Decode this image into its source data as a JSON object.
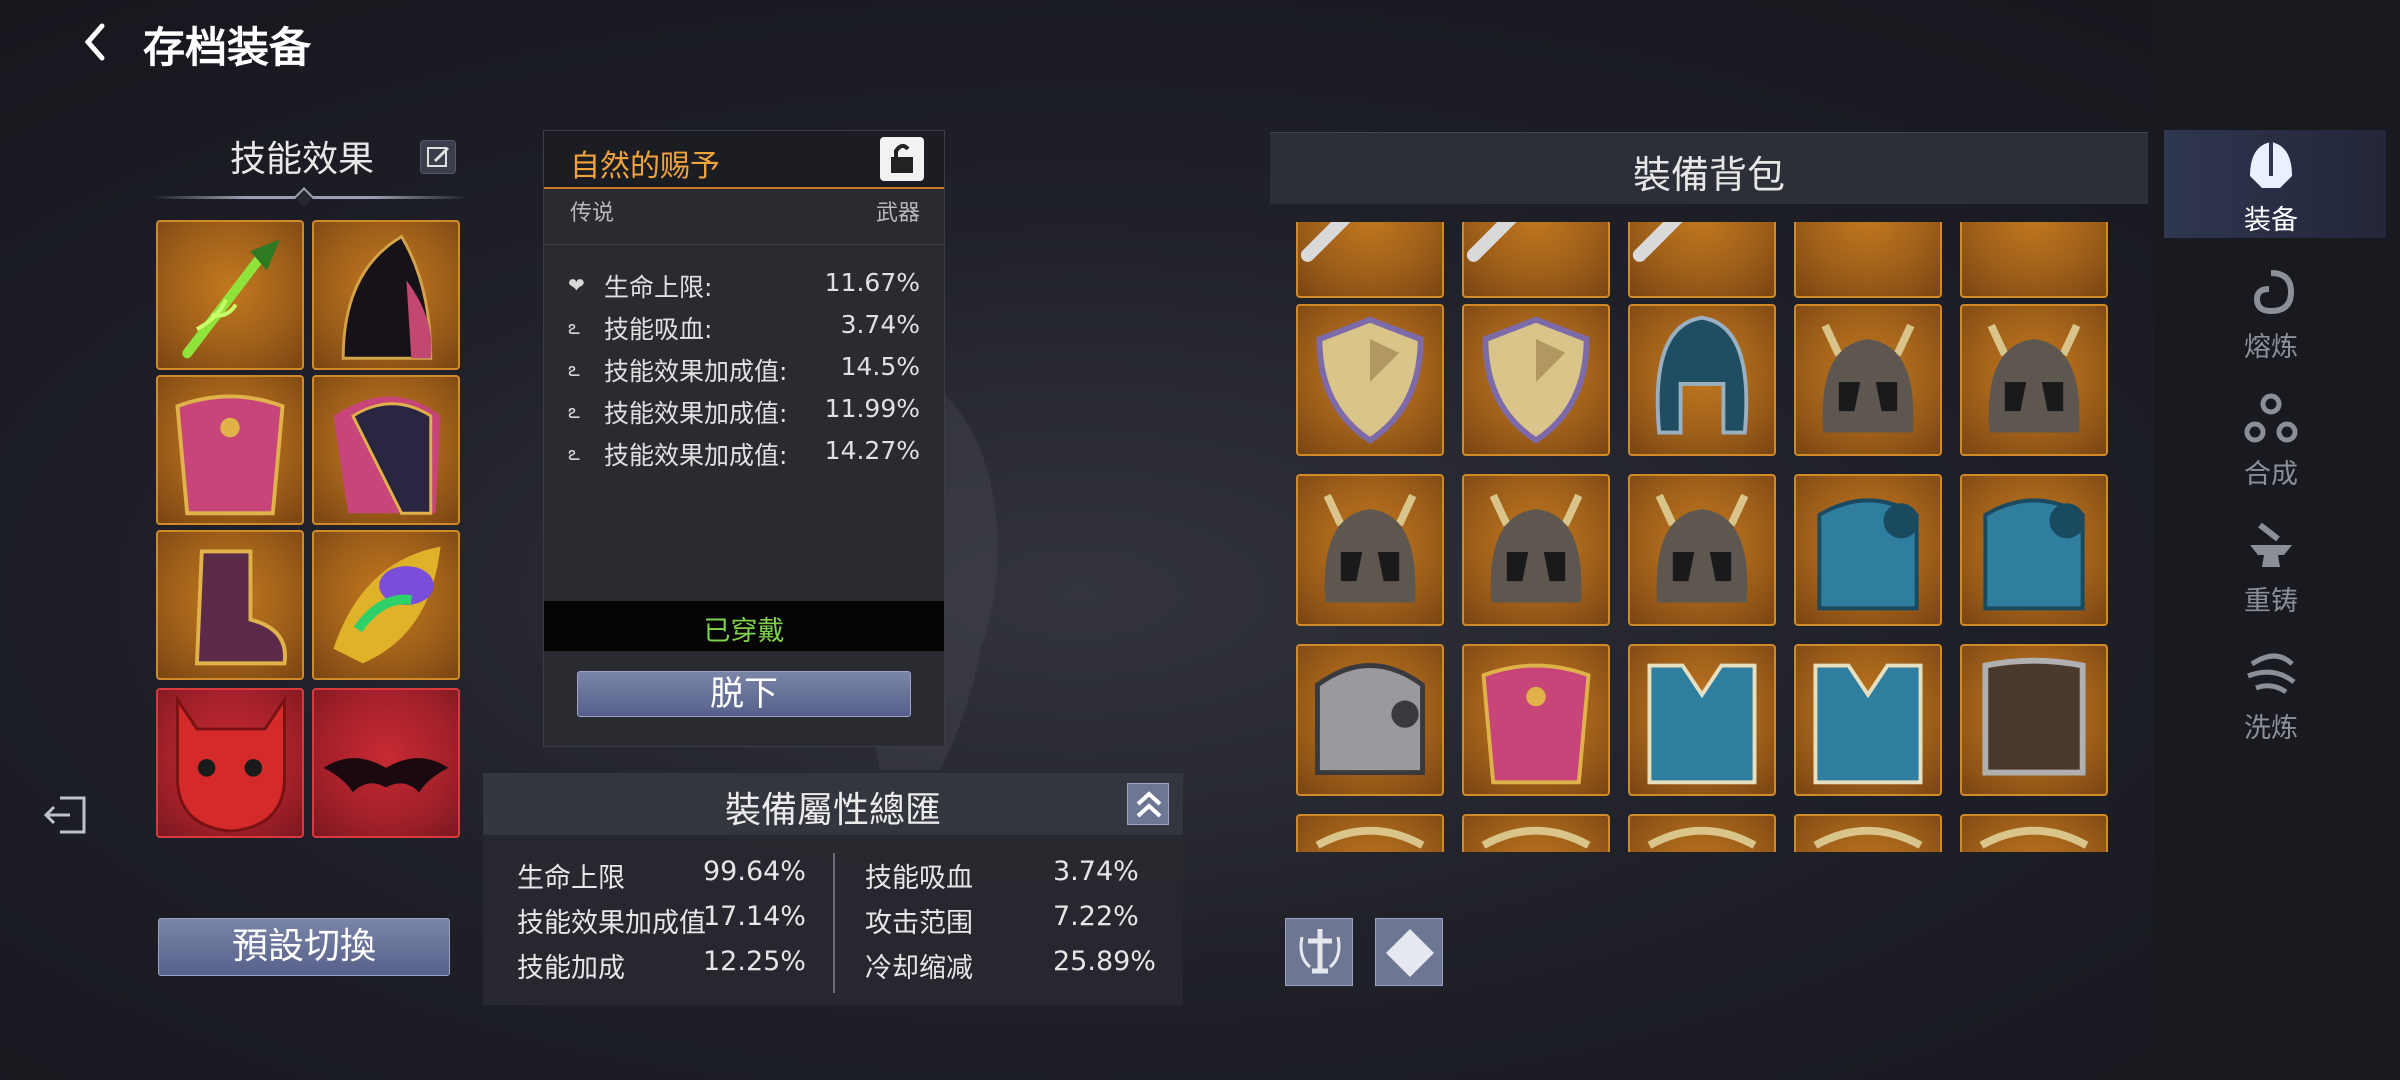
{
  "header": {
    "back_icon": "chevron-left-icon",
    "title": "存档装备"
  },
  "skill_panel": {
    "title": "技能效果",
    "edit_icon": "edit-icon",
    "slots": [
      {
        "icon": "green-staff-icon",
        "rarity_color": "#c2791f"
      },
      {
        "icon": "dark-hood-icon",
        "rarity_color": "#c2791f"
      },
      {
        "icon": "pink-robe-icon",
        "rarity_color": "#c2791f"
      },
      {
        "icon": "dark-cloak-icon",
        "rarity_color": "#c2791f"
      },
      {
        "icon": "purple-boot-icon",
        "rarity_color": "#c2791f"
      },
      {
        "icon": "gem-amulet-icon",
        "rarity_color": "#c2791f"
      },
      {
        "icon": "red-demon-mask-icon",
        "rarity_color": "#c72a32"
      },
      {
        "icon": "bat-wings-icon",
        "rarity_color": "#c72a32"
      }
    ]
  },
  "detail": {
    "name": "自然的赐予",
    "rarity": "传说",
    "slot_type": "武器",
    "lock_icon": "unlock-icon",
    "stats": [
      {
        "icon": "heart-icon",
        "label": "生命上限:",
        "value": "11.67%"
      },
      {
        "icon": "skill-drain-icon",
        "label": "技能吸血:",
        "value": "3.74%"
      },
      {
        "icon": "skill-boost-icon",
        "label": "技能效果加成值:",
        "value": "14.5%"
      },
      {
        "icon": "skill-boost-icon",
        "label": "技能效果加成值:",
        "value": "11.99%"
      },
      {
        "icon": "skill-boost-icon",
        "label": "技能效果加成值:",
        "value": "14.27%"
      }
    ],
    "equipped_label": "已穿戴",
    "unequip_label": "脱下"
  },
  "summary": {
    "title": "裝備屬性總匯",
    "collapse_icon": "double-chevron-up-icon",
    "left": [
      {
        "label": "生命上限",
        "value": "99.64%"
      },
      {
        "label": "技能效果加成值",
        "value": "17.14%"
      },
      {
        "label": "技能加成",
        "value": "12.25%"
      }
    ],
    "right": [
      {
        "label": "技能吸血",
        "value": "3.74%"
      },
      {
        "label": "攻击范围",
        "value": "7.22%"
      },
      {
        "label": "冷却缩减",
        "value": "25.89%"
      }
    ]
  },
  "preset_button": "預設切換",
  "exit_icon": "exit-door-icon",
  "bag": {
    "title": "裝備背包",
    "rows": [
      [
        "sword-icon",
        "sword-icon",
        "sword-icon",
        "shield-edge-icon",
        "shield-edge-icon"
      ],
      [
        "gold-shield-icon",
        "gold-shield-icon",
        "blue-helm-icon",
        "horned-helm-icon",
        "horned-helm-icon"
      ],
      [
        "horned-helm-icon",
        "horned-helm-icon",
        "horned-helm-icon",
        "blue-armor-icon",
        "blue-armor-icon"
      ],
      [
        "steel-pauldron-icon",
        "pink-robe-icon",
        "blue-tunic-icon",
        "blue-tunic-icon",
        "leather-armor-icon"
      ],
      [
        "partial-item-icon",
        "partial-item-icon",
        "partial-item-icon",
        "partial-item-icon",
        "partial-item-icon"
      ]
    ],
    "tools": [
      "sword-sort-icon",
      "gem-sort-icon"
    ]
  },
  "tabs": [
    {
      "label": "装备",
      "icon": "helmet-icon",
      "active": true
    },
    {
      "label": "熔炼",
      "icon": "swirl-icon",
      "active": false
    },
    {
      "label": "合成",
      "icon": "triad-icon",
      "active": false
    },
    {
      "label": "重铸",
      "icon": "anvil-icon",
      "active": false
    },
    {
      "label": "洗炼",
      "icon": "wind-swirl-icon",
      "active": false
    }
  ]
}
